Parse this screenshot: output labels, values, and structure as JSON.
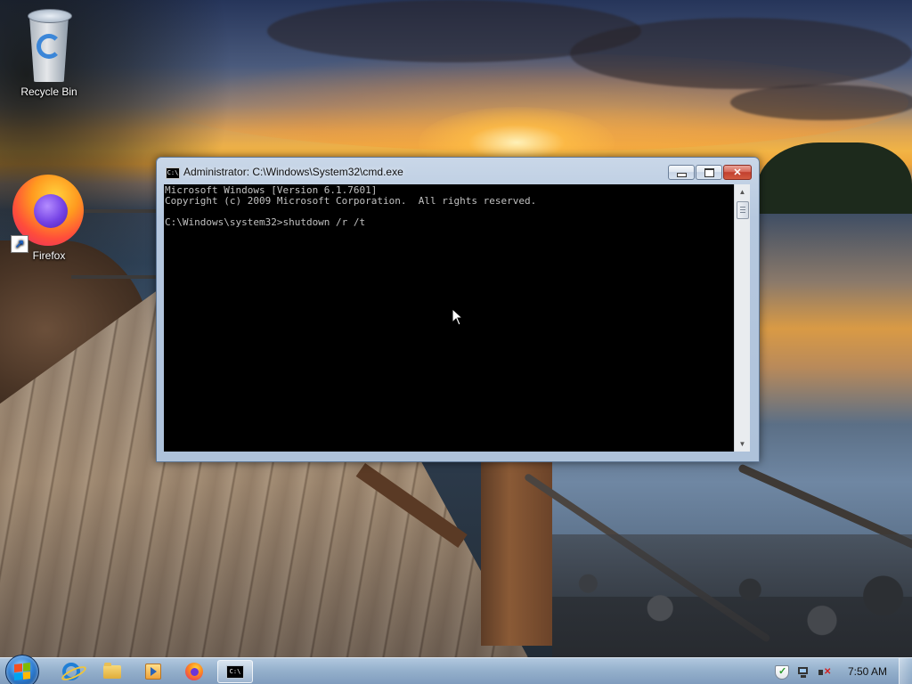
{
  "desktop": {
    "icons": [
      {
        "label": "Recycle Bin",
        "icon": "recycle-bin-icon"
      },
      {
        "label": "Firefox",
        "icon": "firefox-icon"
      }
    ]
  },
  "cmd_window": {
    "title": "Administrator: C:\\Windows\\System32\\cmd.exe",
    "title_icon_text": "C:\\",
    "lines": [
      "Microsoft Windows [Version 6.1.7601]",
      "Copyright (c) 2009 Microsoft Corporation.  All rights reserved.",
      "",
      "C:\\Windows\\system32>shutdown /r /t"
    ],
    "buttons": {
      "minimize": "minimize",
      "maximize": "maximize",
      "close": "✕"
    },
    "scrollbar": {
      "up": "▲",
      "down": "▼"
    }
  },
  "taskbar": {
    "start_flag_colors": [
      "#f25022",
      "#7fba00",
      "#00a4ef",
      "#ffb900"
    ],
    "pinned": [
      {
        "name": "internet-explorer",
        "icon": "ie-icon"
      },
      {
        "name": "windows-explorer",
        "icon": "folder-icon"
      },
      {
        "name": "windows-media-player",
        "icon": "media-icon"
      },
      {
        "name": "firefox",
        "icon": "firefox-icon"
      },
      {
        "name": "command-prompt",
        "icon": "cmd-icon",
        "active": true,
        "icon_text": "C:\\"
      }
    ],
    "tray": {
      "icons": [
        "action-center-icon",
        "network-icon",
        "volume-muted-icon"
      ],
      "clock": "7:50 AM"
    }
  }
}
